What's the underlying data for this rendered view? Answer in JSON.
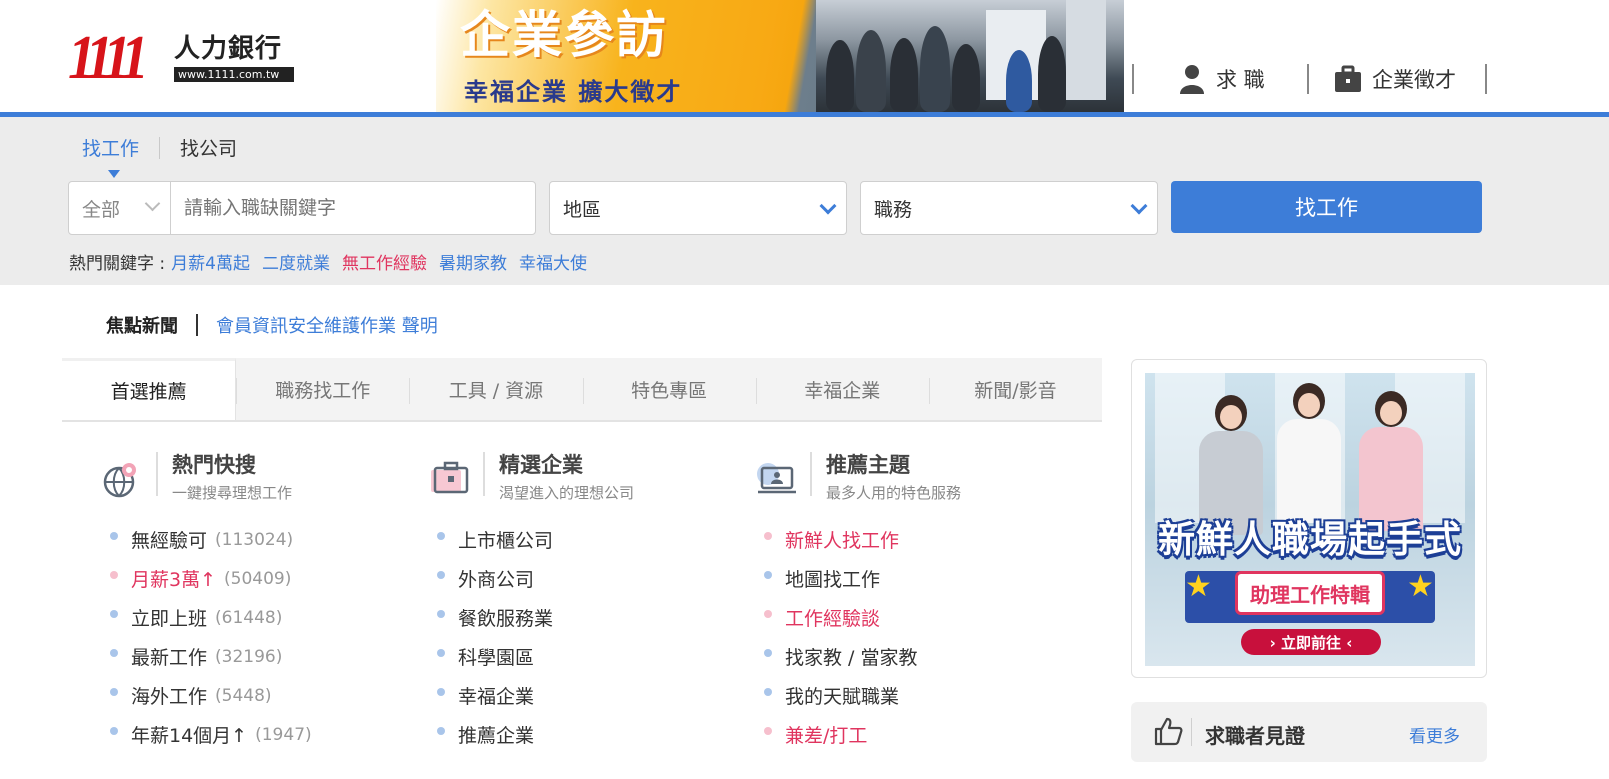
{
  "logo": {
    "number": "1111",
    "name": "人力銀行",
    "url": "www.1111.com.tw"
  },
  "banner": {
    "title": "企業參訪",
    "subtitle": "幸福企業 擴大徵才"
  },
  "top_nav": {
    "job_seek": "求 職",
    "employer": "企業徵才"
  },
  "search": {
    "tabs": [
      "找工作",
      "找公司"
    ],
    "category": "全部",
    "keyword_placeholder": "請輸入職缺關鍵字",
    "area": "地區",
    "job_type": "職務",
    "button": "找工作"
  },
  "hot_keywords": {
    "label": "熱門關鍵字 :",
    "items": [
      "月薪4萬起",
      "二度就業",
      "無工作經驗",
      "暑期家教",
      "幸福大使"
    ]
  },
  "news": {
    "label": "焦點新聞",
    "link": "會員資訊安全維護作業 聲明"
  },
  "main_tabs": [
    "首選推薦",
    "職務找工作",
    "工具 / 資源",
    "特色專區",
    "幸福企業",
    "新聞/影音"
  ],
  "columns": [
    {
      "title": "熱門快搜",
      "subtitle": "一鍵搜尋理想工作",
      "items": [
        {
          "label": "無經驗可",
          "count": "(113024)"
        },
        {
          "label": "月薪3萬↑",
          "count": "(50409)"
        },
        {
          "label": "立即上班",
          "count": "(61448)"
        },
        {
          "label": "最新工作",
          "count": "(32196)"
        },
        {
          "label": "海外工作",
          "count": "(5448)"
        },
        {
          "label": "年薪14個月↑",
          "count": "(1947)"
        }
      ]
    },
    {
      "title": "精選企業",
      "subtitle": "渴望進入的理想公司",
      "items": [
        "上市櫃公司",
        "外商公司",
        "餐飲服務業",
        "科學園區",
        "幸福企業",
        "推薦企業"
      ]
    },
    {
      "title": "推薦主題",
      "subtitle": "最多人用的特色服務",
      "items": [
        "新鮮人找工作",
        "地圖找工作",
        "工作經驗談",
        "找家教 / 當家教",
        "我的天賦職業",
        "兼差/打工"
      ]
    }
  ],
  "ad": {
    "title": "新鮮人職場起手式",
    "subtitle": "助理工作特輯",
    "cta": "› 立即前往 ‹"
  },
  "testimonial": {
    "title": "求職者見證",
    "more": "看更多"
  },
  "colors": {
    "brand_blue": "#3d7dd8",
    "brand_red": "#d7141a",
    "highlight": "#e0355f"
  }
}
